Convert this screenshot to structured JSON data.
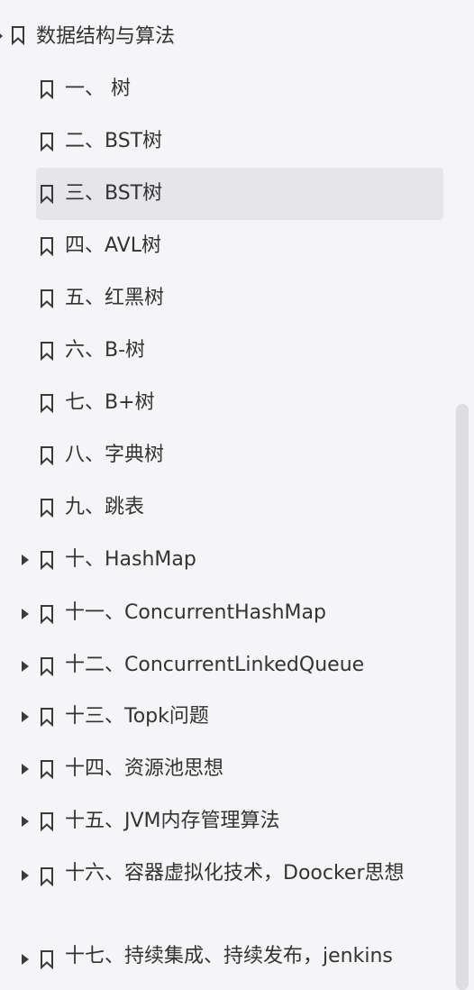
{
  "root": {
    "label": "数据结构与算法"
  },
  "items": [
    {
      "label": "一、 树",
      "expandable": false,
      "selected": false
    },
    {
      "label": "二、BST树",
      "expandable": false,
      "selected": false
    },
    {
      "label": "三、BST树",
      "expandable": false,
      "selected": true
    },
    {
      "label": "四、AVL树",
      "expandable": false,
      "selected": false
    },
    {
      "label": "五、红黑树",
      "expandable": false,
      "selected": false
    },
    {
      "label": "六、B-树",
      "expandable": false,
      "selected": false
    },
    {
      "label": "七、B+树",
      "expandable": false,
      "selected": false
    },
    {
      "label": "八、字典树",
      "expandable": false,
      "selected": false
    },
    {
      "label": "九、跳表",
      "expandable": false,
      "selected": false
    },
    {
      "label": "十、HashMap",
      "expandable": true,
      "selected": false
    },
    {
      "label": "十一、ConcurrentHashMap",
      "expandable": true,
      "selected": false
    },
    {
      "label": "十二、ConcurrentLinkedQueue",
      "expandable": true,
      "selected": false
    },
    {
      "label": "十三、Topk问题",
      "expandable": true,
      "selected": false
    },
    {
      "label": "十四、资源池思想",
      "expandable": true,
      "selected": false
    },
    {
      "label": "十五、JVM内存管理算法",
      "expandable": true,
      "selected": false
    },
    {
      "label": "十六、容器虚拟化技术，Doocker思想",
      "expandable": true,
      "selected": false
    },
    {
      "label": "十七、持续集成、持续发布，jenkins",
      "expandable": true,
      "selected": false
    }
  ],
  "colors": {
    "background": "#f5f4f7",
    "selected": "#e6e5e9",
    "text": "#333333",
    "icon": "#3a3a3a"
  },
  "icons": {
    "bookmark": "bookmark-icon",
    "expand": "caret-right-icon"
  }
}
